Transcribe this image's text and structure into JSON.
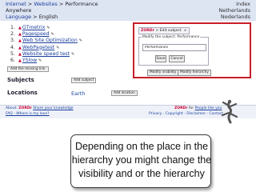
{
  "header": {
    "breadcrumb": [
      "Internet",
      "Websites",
      "Performance"
    ],
    "separator": ">",
    "anywhere": "Anywhere",
    "language_label": "Language",
    "language_sep": ">",
    "language_value": "English",
    "top_links": [
      "Index",
      "Netherlands",
      "Nederlands"
    ]
  },
  "list": {
    "items": [
      {
        "num": "1.",
        "label": "GTmetrix"
      },
      {
        "num": "2.",
        "label": "Pagespeed"
      },
      {
        "num": "3.",
        "label": "Web Site Optimization"
      },
      {
        "num": "4.",
        "label": "WebPagetest"
      },
      {
        "num": "5.",
        "label": "Website speed test"
      },
      {
        "num": "6.",
        "label": "YSlow"
      }
    ],
    "add_missing": "Add the missing link"
  },
  "sections": {
    "subjects_label": "Subjects",
    "add_subject": "Add subject",
    "locations_label": "Locations",
    "location_value": "Earth",
    "add_location": "Add location"
  },
  "dialog": {
    "title_brand": "ZORDr",
    "title_sep": ">",
    "title_text": "Edit subject",
    "close": "x",
    "legend": "Modify the subject: Performance",
    "input_value": "Performance",
    "save": "Save",
    "cancel": "Cancel",
    "modify_visibility": "Modify visibility",
    "modify_hierarchy": "Modify hierarchy"
  },
  "footer": {
    "about": "About:",
    "brand": "ZORDr",
    "share": "Share your knowledge",
    "faq": "FAQ - Where is my love?",
    "right_brand": "ZORDr",
    "right_for": "for",
    "right_people": "People like you",
    "right_links": "Privacy - Copyright - Disclaimer - Contact"
  },
  "caption": {
    "line1": "Depending on the place in the",
    "line2": "hierarchy you might change the",
    "line3": "visibility and or the hierarchy"
  },
  "colors": {
    "callout_border": "#c81e2a",
    "link": "#1a3f9e",
    "header_band": "#dde4f2"
  }
}
